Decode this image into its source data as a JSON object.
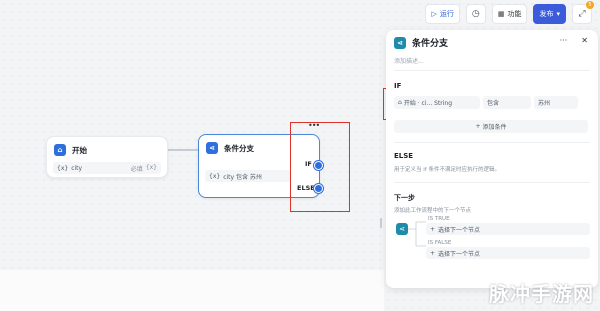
{
  "topbar": {
    "run_label": "运行",
    "function_label": "功能",
    "publish_label": "发布",
    "notification_count": "5"
  },
  "start_node": {
    "title": "开始",
    "var_type": "{x}",
    "var_name": "city",
    "required_label": "必填",
    "required_type": "{x}"
  },
  "condition_node": {
    "title": "条件分支",
    "condition_text": "city 包含 苏州",
    "var_type": "{x}",
    "if_label": "IF",
    "else_label": "ELSE"
  },
  "panel": {
    "title": "条件分支",
    "description_placeholder": "添加描述...",
    "if_section": {
      "label": "IF",
      "variable": "开始 · ci... String",
      "operator": "包含",
      "value": "苏州",
      "add_condition_label": "添加条件"
    },
    "else_section": {
      "label": "ELSE",
      "description": "用于定义当 if 条件不满足时应执行的逻辑。"
    },
    "next_step": {
      "label": "下一步",
      "description": "添加此工作流程中的下一个节点",
      "true_label": "IS TRUE",
      "true_action": "选择下一个节点",
      "false_label": "IS FALSE",
      "false_action": "选择下一个节点"
    }
  },
  "watermark": "脉冲手游网",
  "colors": {
    "accent": "#3b5bdb",
    "node_blue": "#2f6fdc",
    "node_teal": "#1e8ca8",
    "highlight_red": "#e0342b"
  }
}
